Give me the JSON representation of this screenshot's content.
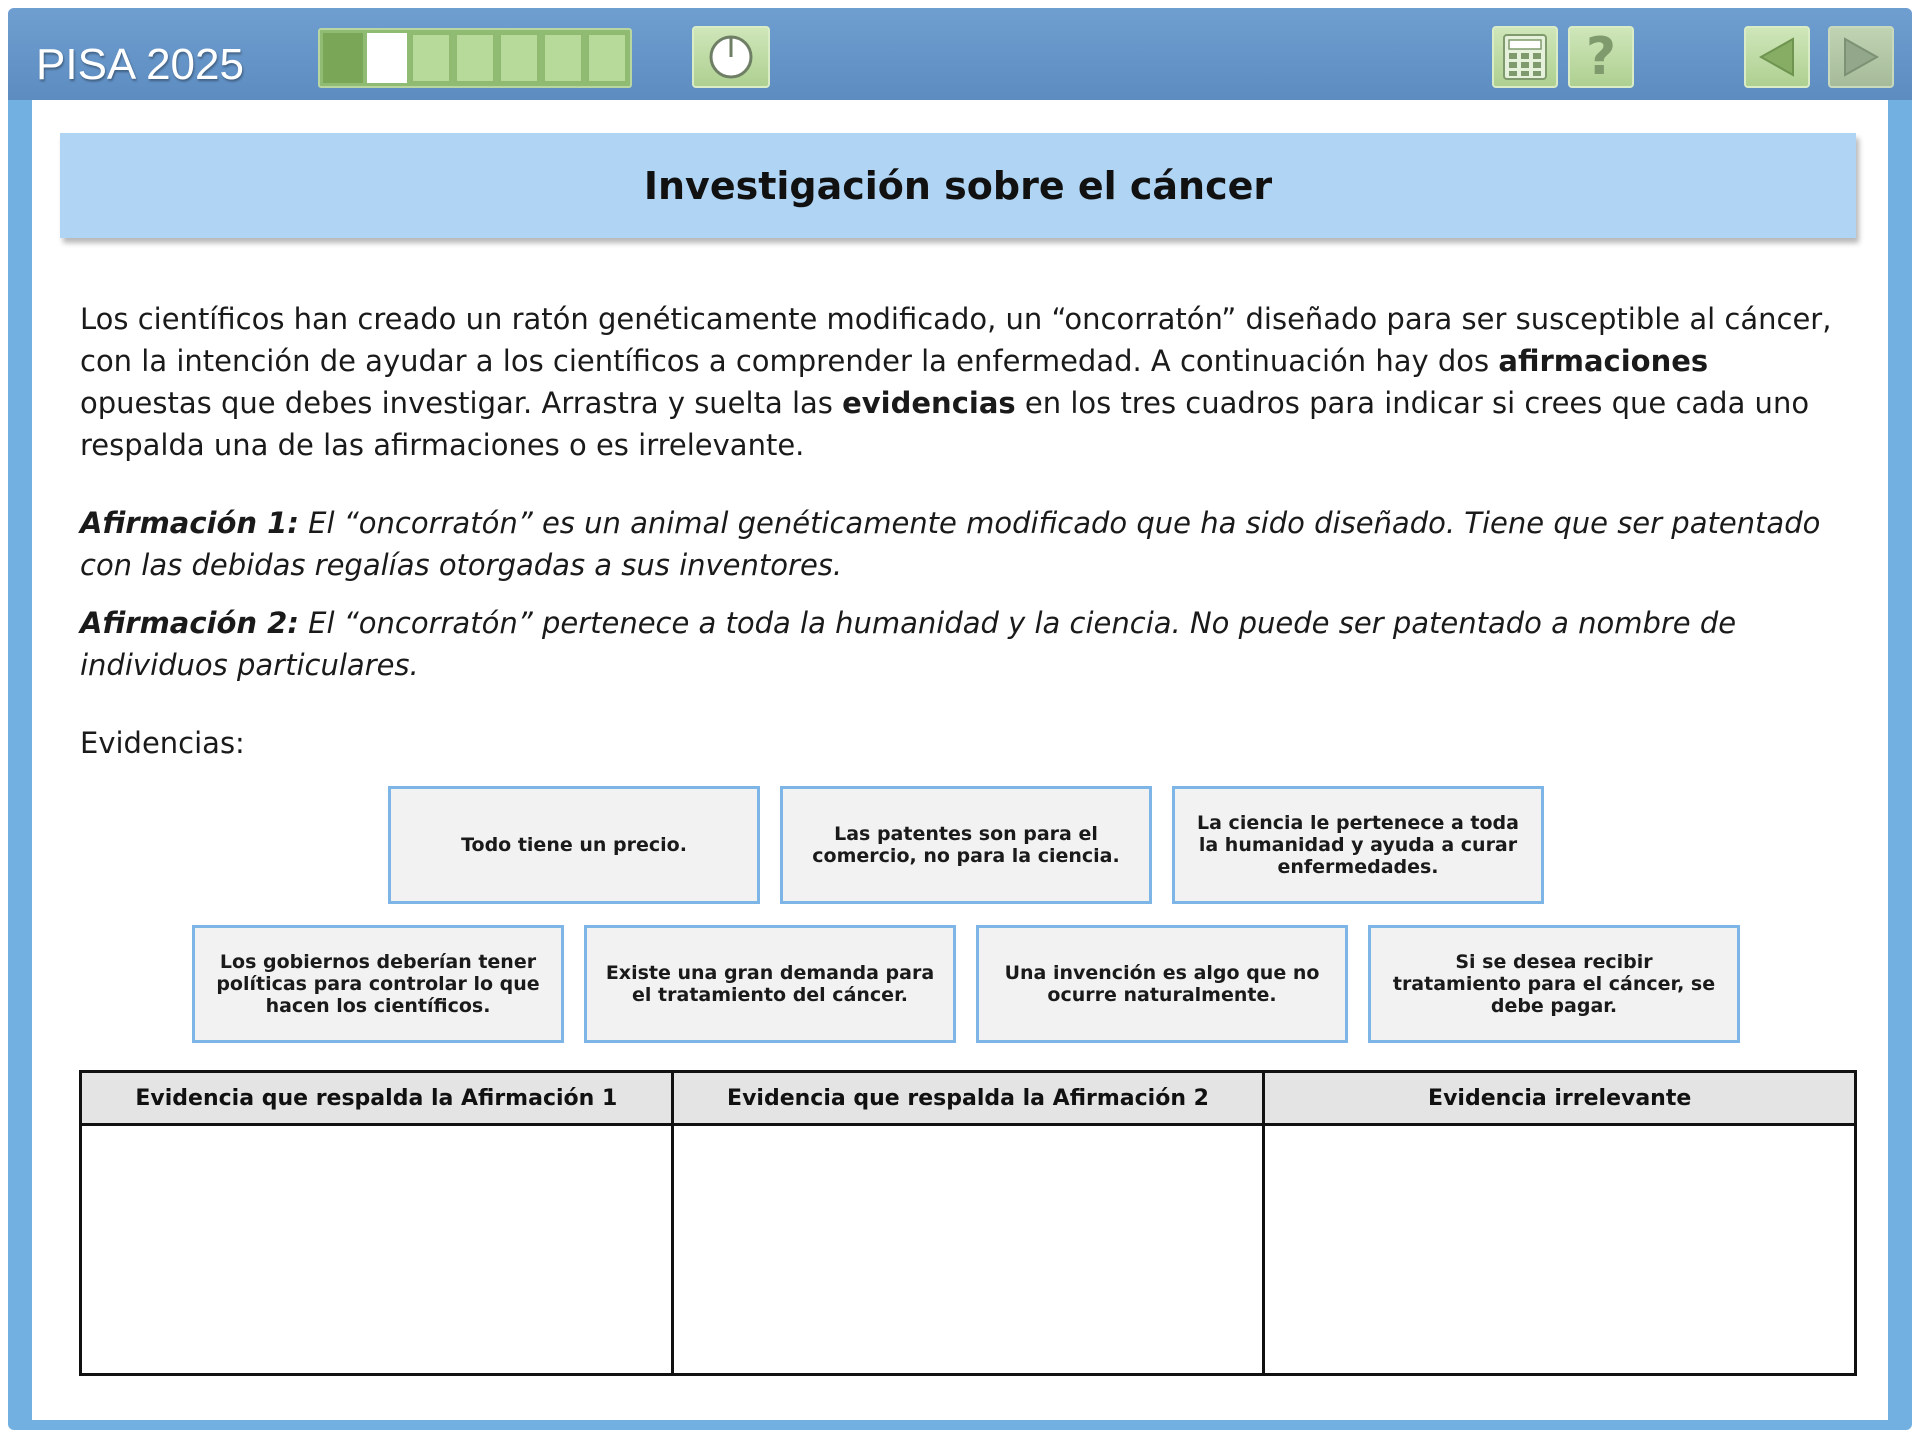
{
  "app": {
    "brand": "PISA 2025",
    "progress": {
      "total_segments": 7,
      "completed": 1,
      "current_index": 1
    }
  },
  "toolbar": {
    "timer_icon": "timer-icon",
    "calculator_icon": "calculator-icon",
    "help_label": "?",
    "back_icon": "arrow-left-icon",
    "next_icon": "arrow-right-icon"
  },
  "colors": {
    "header_blue": "#5d8cc1",
    "frame_blue": "#73b0e2",
    "title_bg": "#b0d4f3",
    "tool_green": "#aed091",
    "card_border": "#7db6e6"
  },
  "page": {
    "title": "Investigación sobre el cáncer",
    "intro": {
      "p1": "Los científicos han creado un ratón genéticamente modificado, un “oncorratón” diseñado para ser susceptible al cáncer, con la intención de ayudar a los científicos a comprender la enfermedad. A continuación hay dos ",
      "b1": "afirmaciones",
      "p2": " opuestas que debes investigar. Arrastra y suelta las ",
      "b2": "evidencias",
      "p3": " en los tres cuadros para indicar si crees que cada uno respalda una de las afirmaciones o es irrelevante."
    },
    "claim1": {
      "label": "Afirmación 1:",
      "text": " El “oncorratón” es un animal genéticamente modificado que ha sido diseñado. Tiene que ser patentado con las debidas regalías otorgadas a sus inventores."
    },
    "claim2": {
      "label": "Afirmación 2:",
      "text": " El “oncorratón” pertenece a toda la humanidad y la ciencia. No puede ser patentado a nombre de individuos particulares."
    },
    "evidence_label": "Evidencias:",
    "evidence": [
      "Todo tiene un precio.",
      "Las patentes son para el comercio, no para la ciencia.",
      "La ciencia le pertenece a toda la humanidad y ayuda a curar enfermedades.",
      "Los gobiernos deberían tener políticas para controlar lo que hacen los científicos.",
      "Existe una gran demanda para el tratamiento del cáncer.",
      "Una invención es algo que no ocurre naturalmente.",
      "Si se desea recibir tratamiento para el cáncer, se debe pagar."
    ],
    "drop_columns": [
      "Evidencia que respalda la Afirmación 1",
      "Evidencia que respalda la Afirmación 2",
      "Evidencia irrelevante"
    ]
  }
}
